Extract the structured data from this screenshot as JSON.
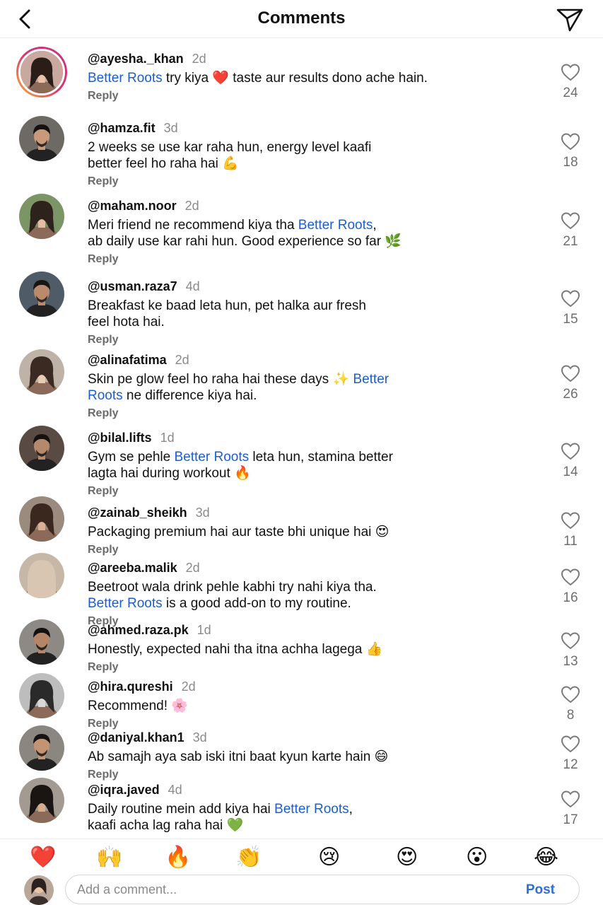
{
  "header": {
    "title": "Comments"
  },
  "comments": [
    {
      "user": "@ayesha._khan",
      "time": "2d",
      "likes": "24",
      "lines": [
        [
          {
            "t": "Better Roots",
            "brand": true
          },
          {
            "t": " try kiya ❤️ taste aur results dono ache hain."
          }
        ]
      ],
      "reply": "Reply"
    },
    {
      "user": "@hamza.fit",
      "time": "3d",
      "likes": "18",
      "lines": [
        [
          {
            "t": "2 weeks se use kar raha hun, energy level kaafi"
          }
        ],
        [
          {
            "t": "better feel ho raha hai 💪"
          }
        ]
      ],
      "reply": "Reply"
    },
    {
      "user": "@maham.noor",
      "time": "2d",
      "likes": "21",
      "lines": [
        [
          {
            "t": "Meri friend ne recommend kiya tha "
          },
          {
            "t": "Better Roots",
            "brand": true
          },
          {
            "t": ","
          }
        ],
        [
          {
            "t": "ab daily use kar rahi hun. Good experience so far 🌿"
          }
        ]
      ],
      "reply": "Reply"
    },
    {
      "user": "@usman.raza7",
      "time": "4d",
      "likes": "15",
      "lines": [
        [
          {
            "t": "Breakfast ke baad leta hun, pet halka aur fresh"
          }
        ],
        [
          {
            "t": "feel hota hai."
          }
        ]
      ],
      "reply": "Reply"
    },
    {
      "user": "@alinafatima",
      "time": "2d",
      "likes": "26",
      "lines": [
        [
          {
            "t": "Skin pe glow feel ho raha hai these days ✨ "
          },
          {
            "t": "Better",
            "brand": true
          }
        ],
        [
          {
            "t": "Roots",
            "brand": true
          },
          {
            "t": " ne difference kiya hai."
          }
        ]
      ],
      "reply": "Reply"
    },
    {
      "user": "@bilal.lifts",
      "time": "1d",
      "likes": "14",
      "lines": [
        [
          {
            "t": "Gym se pehle "
          },
          {
            "t": "Better Roots",
            "brand": true
          },
          {
            "t": " leta hun, stamina better"
          }
        ],
        [
          {
            "t": "lagta hai during workout 🔥"
          }
        ]
      ],
      "reply": "Reply"
    },
    {
      "user": "@zainab_sheikh",
      "time": "3d",
      "likes": "11",
      "lines": [
        [
          {
            "t": "Packaging premium hai aur taste bhi unique hai 😍"
          }
        ]
      ],
      "reply": "Reply"
    },
    {
      "user": "@areeba.malik",
      "time": "2d",
      "likes": "16",
      "lines": [
        [
          {
            "t": "Beetroot wala drink pehle kabhi try nahi kiya tha."
          }
        ],
        [
          {
            "t": "Better Roots",
            "brand": true
          },
          {
            "t": " is a good add-on to my routine."
          }
        ]
      ],
      "reply": "Reply"
    },
    {
      "user": "@ahmed.raza.pk",
      "time": "1d",
      "likes": "13",
      "lines": [
        [
          {
            "t": "Honestly, expected nahi tha itna achha lagega 👍"
          }
        ]
      ],
      "reply": "Reply"
    },
    {
      "user": "@hira.qureshi",
      "time": "2d",
      "likes": "8",
      "lines": [
        [
          {
            "t": "Recommend! 🌸"
          }
        ]
      ],
      "reply": "Reply"
    },
    {
      "user": "@daniyal.khan1",
      "time": "3d",
      "likes": "12",
      "lines": [
        [
          {
            "t": "Ab samajh aya sab iski itni baat kyun karte hain 😄"
          }
        ]
      ],
      "reply": "Reply"
    },
    {
      "user": "@iqra.javed",
      "time": "4d",
      "likes": "17",
      "lines": [
        [
          {
            "t": "Daily routine mein add kiya hai "
          },
          {
            "t": "Better Roots",
            "brand": true
          },
          {
            "t": ","
          }
        ],
        [
          {
            "t": "kaafi acha lag raha hai 💚"
          }
        ]
      ],
      "reply": "Reply"
    }
  ],
  "reactions": [
    "❤️",
    "🙌",
    "🔥",
    "👏",
    "😢",
    "😍",
    "😮",
    "😂"
  ],
  "composer": {
    "placeholder": "Add a comment...",
    "post_label": "Post"
  },
  "colors": {
    "brand": "#1a5fd0",
    "post": "#2a6fdb",
    "muted": "#8a8a8a"
  }
}
